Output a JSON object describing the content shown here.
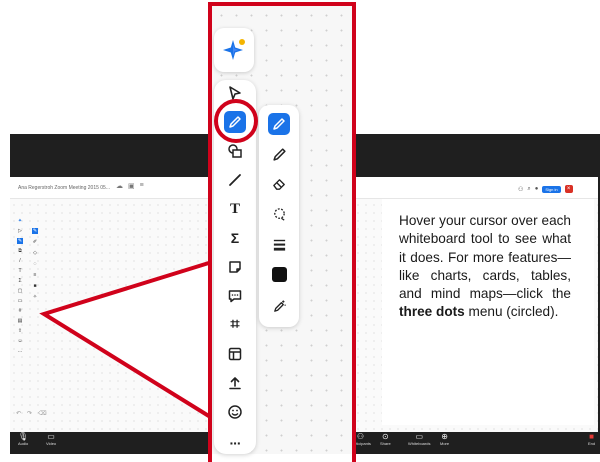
{
  "background_app": {
    "document_title": "Ana Regerstroh Zoom Meeting 2015 05...",
    "signin_label": "Sign in",
    "bottom_bar": [
      {
        "label": "Audio",
        "icon": "mic-icon"
      },
      {
        "label": "Video",
        "icon": "video-icon"
      },
      {
        "label": "Participants",
        "icon": "people-icon"
      },
      {
        "label": "Share",
        "icon": "share-icon"
      },
      {
        "label": "Whiteboards",
        "icon": "whiteboard-icon"
      },
      {
        "label": "More",
        "icon": "more-icon"
      },
      {
        "label": "End",
        "icon": "end-icon"
      }
    ]
  },
  "zoom_toolbar": {
    "main_tools": [
      {
        "name": "select",
        "icon": "cursor-arrow-icon"
      },
      {
        "name": "pen",
        "icon": "pencil-icon",
        "active": true
      },
      {
        "name": "shapes",
        "icon": "shapes-icon"
      },
      {
        "name": "line",
        "icon": "line-icon"
      },
      {
        "name": "text",
        "icon": "text-icon",
        "glyph": "T"
      },
      {
        "name": "formula",
        "icon": "sigma-icon",
        "glyph": "Σ"
      },
      {
        "name": "sticky-note",
        "icon": "sticky-note-icon"
      },
      {
        "name": "comment",
        "icon": "comment-icon"
      },
      {
        "name": "frame",
        "icon": "frame-icon",
        "glyph": "⌗"
      },
      {
        "name": "template",
        "icon": "template-icon"
      },
      {
        "name": "upload",
        "icon": "upload-icon"
      },
      {
        "name": "reaction",
        "icon": "smiley-icon"
      },
      {
        "name": "more",
        "icon": "more-dots-icon",
        "glyph": "···"
      }
    ],
    "pen_tools": [
      {
        "name": "pen",
        "icon": "pen-icon",
        "active": true
      },
      {
        "name": "highlighter",
        "icon": "highlighter-icon"
      },
      {
        "name": "eraser",
        "icon": "eraser-icon"
      },
      {
        "name": "lasso",
        "icon": "lasso-icon"
      },
      {
        "name": "stroke-width",
        "icon": "stroke-width-icon"
      },
      {
        "name": "color",
        "icon": "color-swatch-icon",
        "color": "#111111"
      },
      {
        "name": "magic-pen",
        "icon": "magic-pen-icon"
      }
    ]
  },
  "callout": {
    "text_before": "Hover your cursor over each whiteboard tool to see what it does. For more features—like charts, cards, tables, and mind maps—click the ",
    "bold": "three dots",
    "text_after": " menu (circled)."
  },
  "colors": {
    "highlight_red": "#d0021b",
    "accent_blue": "#1a73e8",
    "dark_chrome": "#1f1f1f"
  }
}
